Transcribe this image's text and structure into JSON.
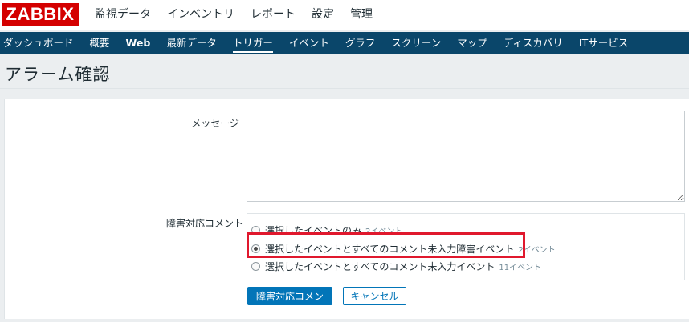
{
  "header": {
    "logo": "ZABBIX",
    "menu": [
      "監視データ",
      "インベントリ",
      "レポート",
      "設定",
      "管理"
    ]
  },
  "subnav": {
    "items": [
      "ダッシュボード",
      "概要",
      "Web",
      "最新データ",
      "トリガー",
      "イベント",
      "グラフ",
      "スクリーン",
      "マップ",
      "ディスカバリ",
      "ITサービス"
    ],
    "selected": "トリガー"
  },
  "page": {
    "title": "アラーム確認"
  },
  "form": {
    "message_label": "メッセージ",
    "message_value": "",
    "ack_label": "障害対応コメント",
    "options": [
      {
        "label": "選択したイベントのみ",
        "count": "2イベント",
        "selected": false
      },
      {
        "label": "選択したイベントとすべてのコメント未入力障害イベント",
        "count": "2イベント",
        "selected": true
      },
      {
        "label": "選択したイベントとすべてのコメント未入力イベント",
        "count": "11イベント",
        "selected": false
      }
    ],
    "submit_label": "障害対応コメント",
    "cancel_label": "キャンセル"
  },
  "colors": {
    "brand_red": "#d40000",
    "nav_blue": "#0a466a",
    "button_blue": "#0275b8",
    "highlight_red": "#e0182d"
  }
}
